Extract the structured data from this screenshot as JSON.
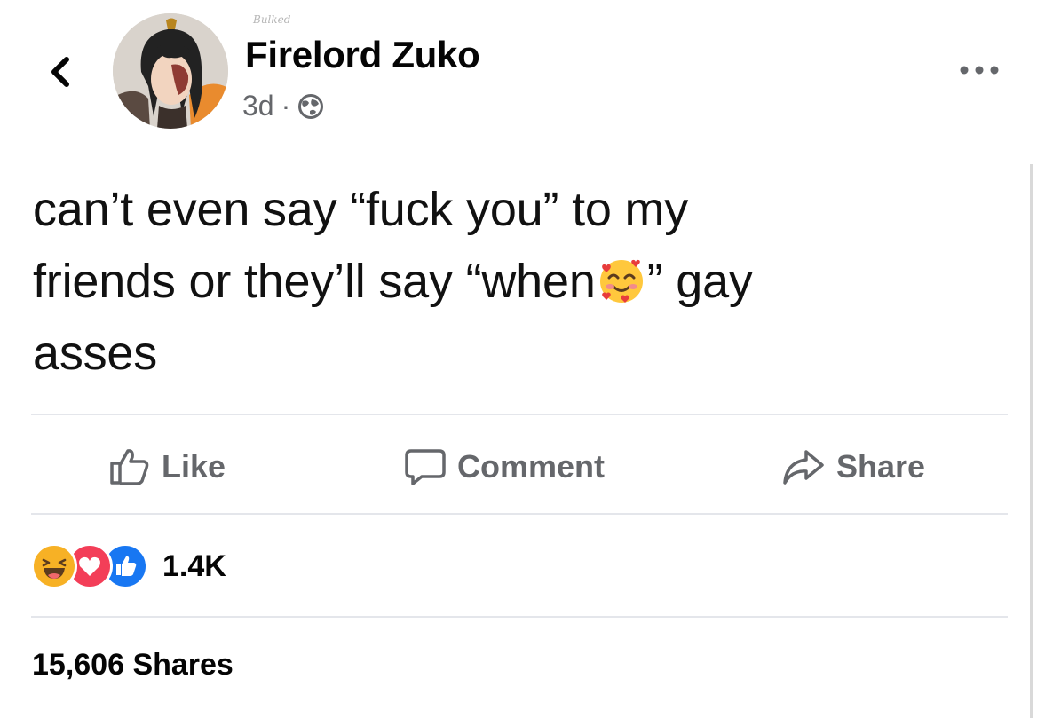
{
  "post": {
    "author": "Firelord Zuko",
    "avatar_badge": "Bulked",
    "time": "3d",
    "separator": "·",
    "privacy_icon": "globe-icon",
    "text_lines": [
      "can’t even say “fuck you” to my",
      "friends or they’ll say “when",
      "” gay",
      "asses"
    ],
    "emoji": "smiling-face-with-hearts"
  },
  "actions": {
    "like": "Like",
    "comment": "Comment",
    "share": "Share"
  },
  "stats": {
    "reaction_icons": [
      "haha-icon",
      "love-icon",
      "like-icon"
    ],
    "reaction_count": "1.4K",
    "shares": "15,606 Shares"
  },
  "colors": {
    "text_primary": "#050505",
    "text_secondary": "#65676b",
    "divider": "#e4e6eb",
    "like_blue": "#1877f2",
    "love_red": "#f33e58",
    "haha_yellow": "#f7b125"
  }
}
